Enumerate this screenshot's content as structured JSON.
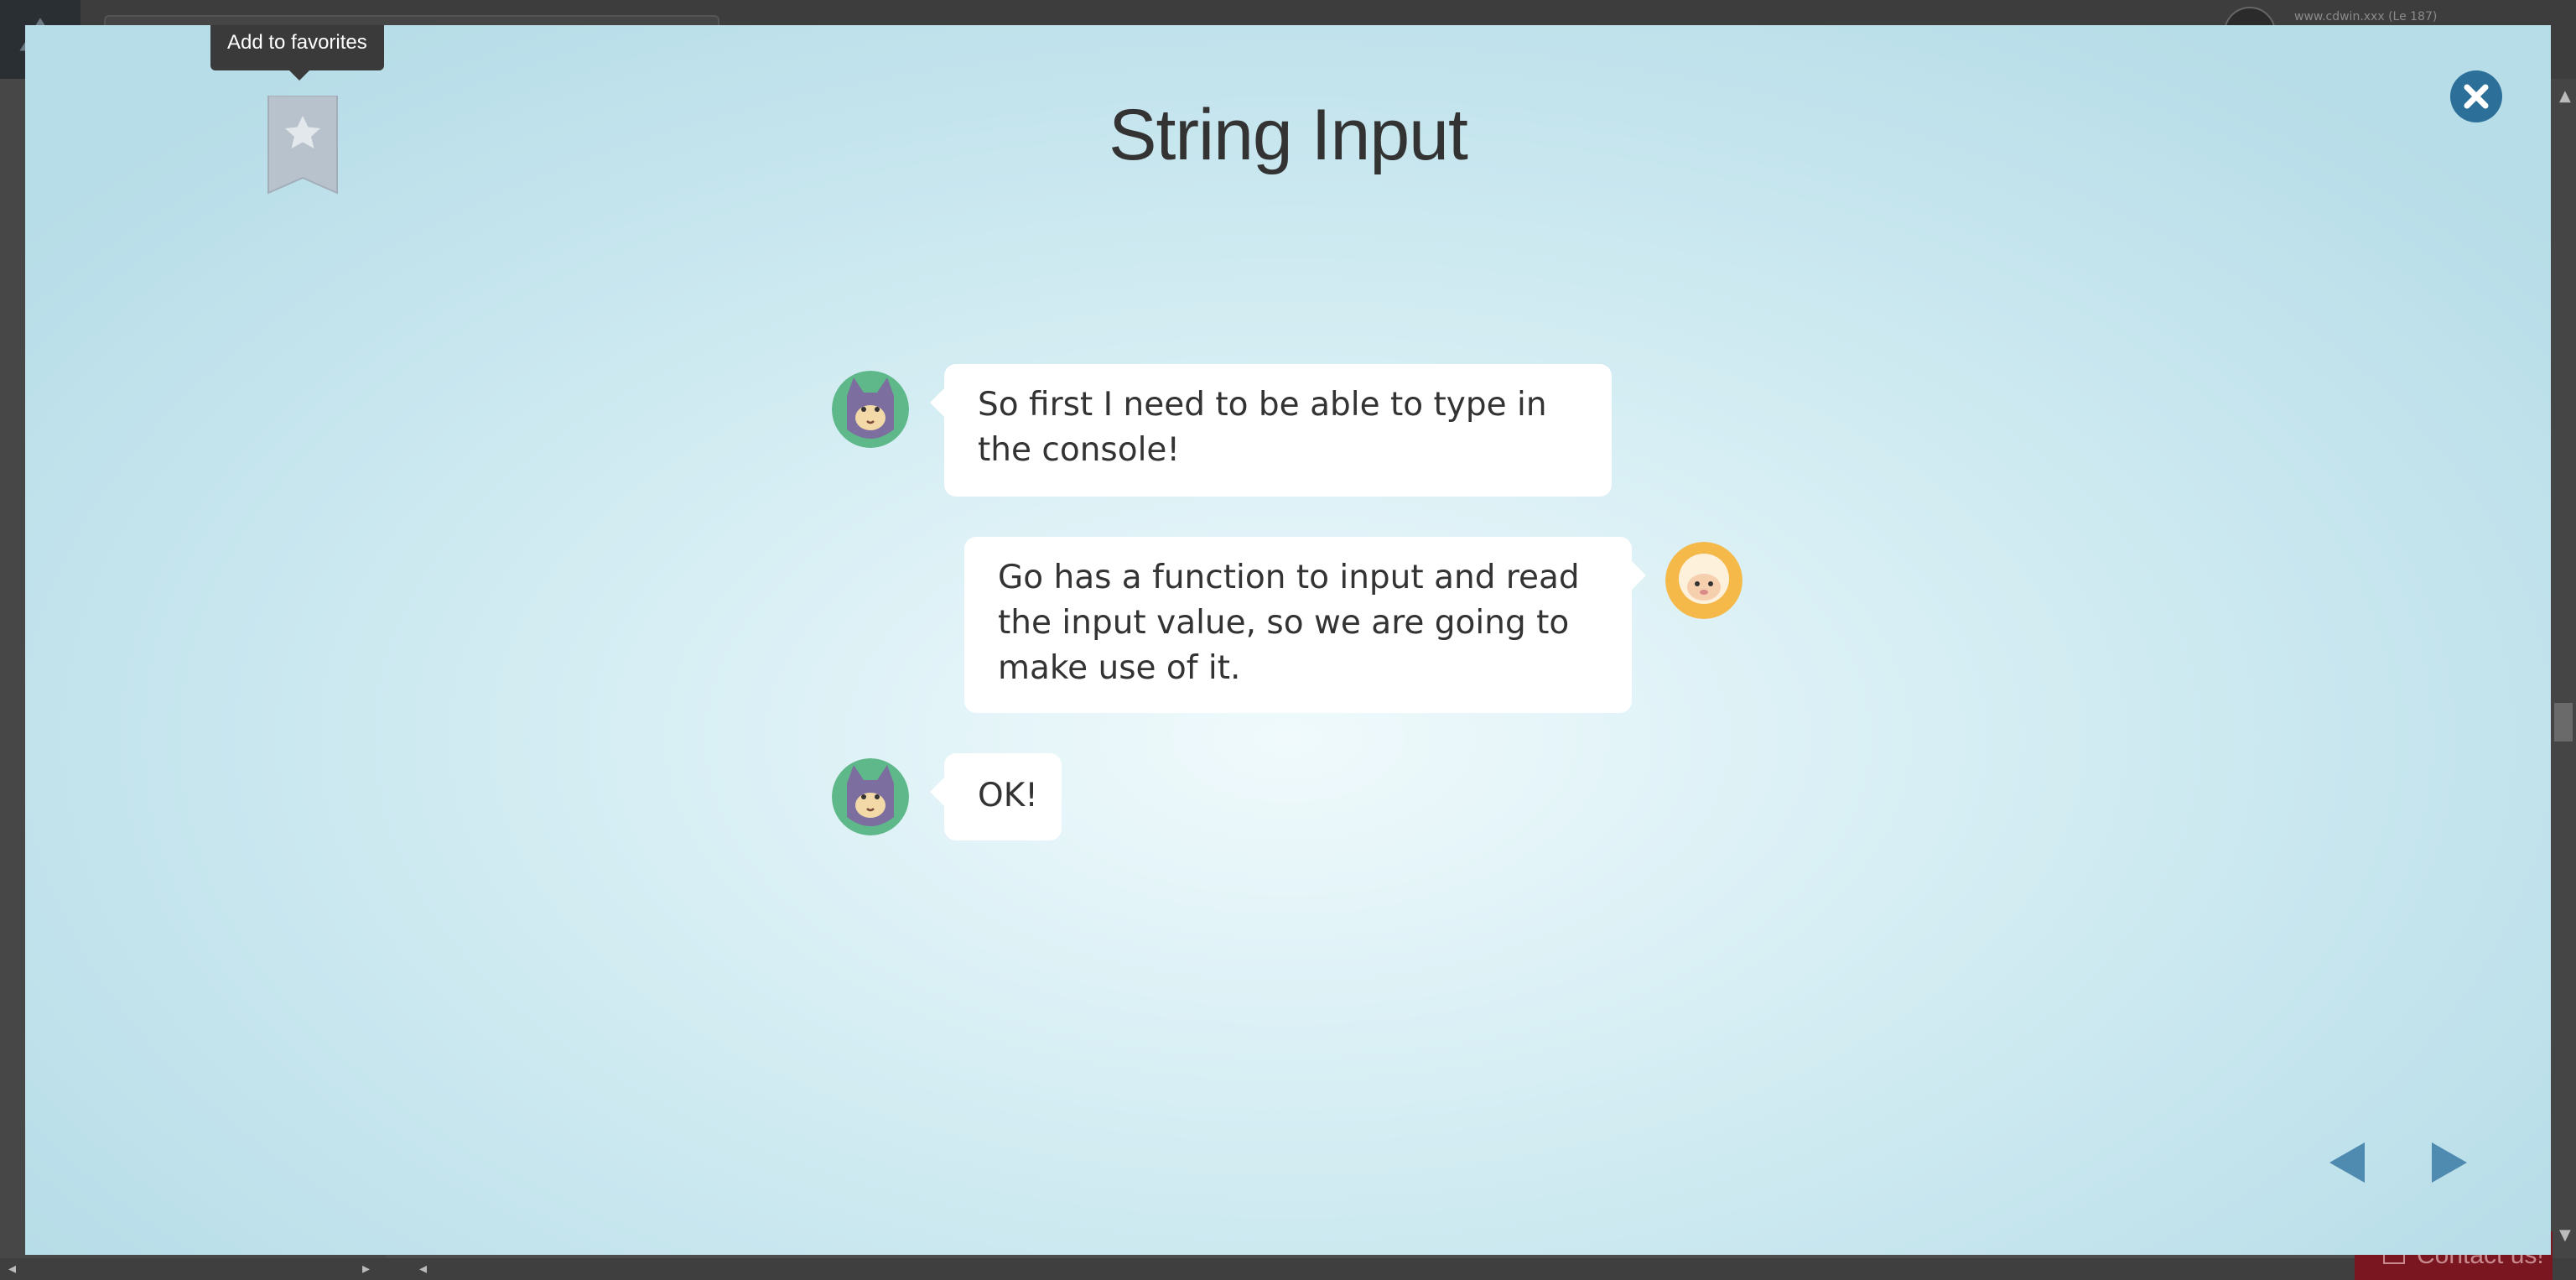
{
  "background": {
    "user_text": "www.cdwin.xxx (Le 187)"
  },
  "modal": {
    "title": "String Input",
    "favorite_tooltip": "Add to favorites",
    "messages": [
      {
        "speaker": "cat",
        "side": "left",
        "text": "So first I need to be able to type in the console!"
      },
      {
        "speaker": "sheep",
        "side": "right",
        "text": "Go has a function to input and read the input value, so we are going to make use of it."
      },
      {
        "speaker": "cat",
        "side": "left",
        "text": "OK!"
      }
    ]
  },
  "contact": {
    "label": "Contact us!"
  },
  "icons": {
    "close": "close-icon",
    "favorite": "bookmark-star-icon",
    "prev": "arrow-left-icon",
    "next": "arrow-right-icon"
  },
  "colors": {
    "close_button": "#2c6f99",
    "nav_arrow": "#4f8bb0",
    "bookmark": "#b8c2cc"
  }
}
